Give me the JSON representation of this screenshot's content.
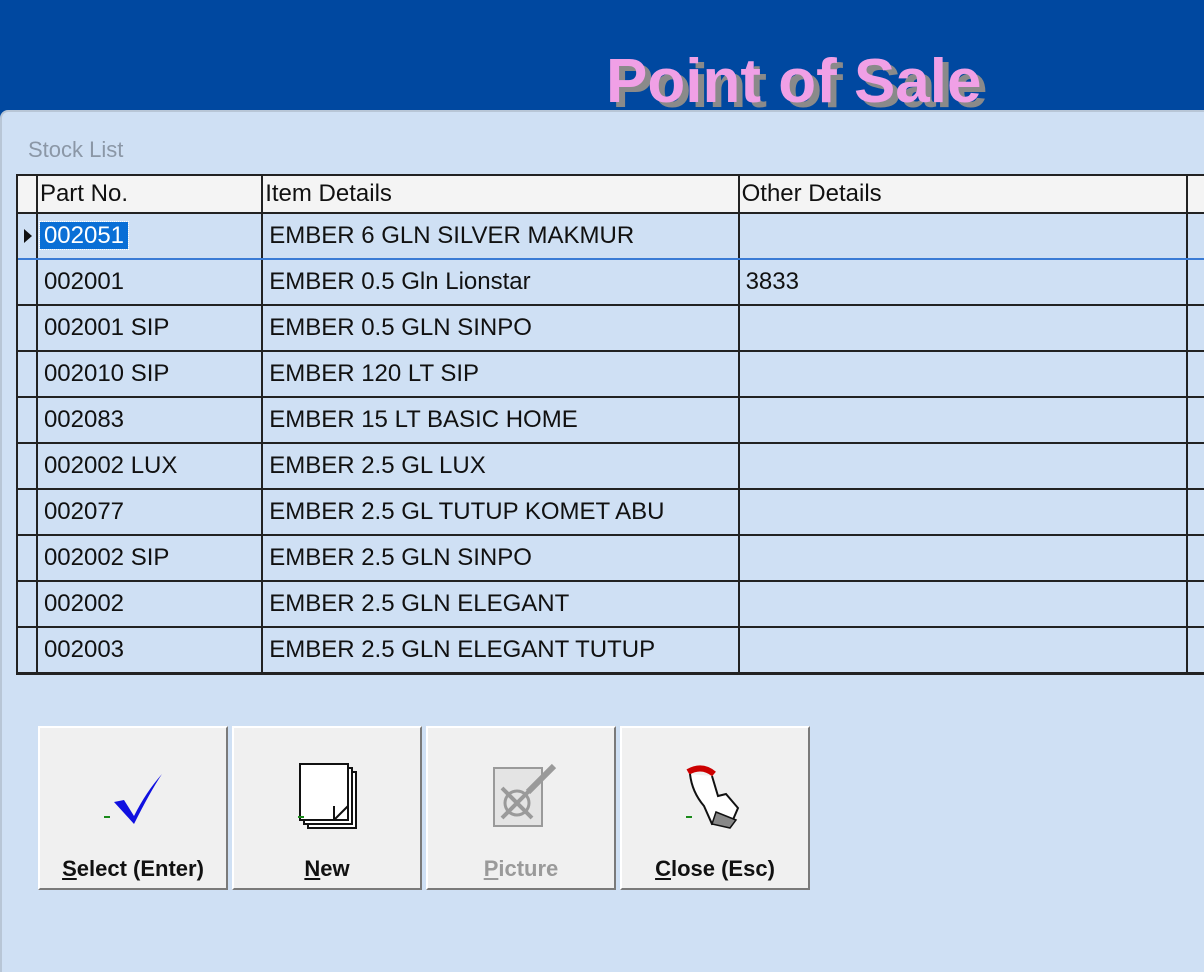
{
  "app": {
    "title": "Point of Sale"
  },
  "window": {
    "caption": "Stock List"
  },
  "grid": {
    "columns": [
      "Part No.",
      "Item Details",
      "Other Details"
    ],
    "rows": [
      {
        "part_no": "002051",
        "item_details": "EMBER  6 GLN SILVER  MAKMUR",
        "other_details": ""
      },
      {
        "part_no": "002001",
        "item_details": "EMBER 0.5 Gln Lionstar",
        "other_details": "3833"
      },
      {
        "part_no": "002001 SIP",
        "item_details": "EMBER 0.5 GLN SINPO",
        "other_details": ""
      },
      {
        "part_no": "002010 SIP",
        "item_details": "EMBER 120 LT SIP",
        "other_details": ""
      },
      {
        "part_no": "002083",
        "item_details": "EMBER 15 LT BASIC HOME",
        "other_details": ""
      },
      {
        "part_no": "002002 LUX",
        "item_details": "EMBER 2.5 GL LUX",
        "other_details": ""
      },
      {
        "part_no": "002077",
        "item_details": "EMBER 2.5 GL TUTUP KOMET ABU",
        "other_details": ""
      },
      {
        "part_no": "002002 SIP",
        "item_details": "EMBER 2.5 GLN  SINPO",
        "other_details": ""
      },
      {
        "part_no": "002002",
        "item_details": "EMBER 2.5 GLN ELEGANT",
        "other_details": ""
      },
      {
        "part_no": "002003",
        "item_details": "EMBER 2.5 GLN ELEGANT TUTUP",
        "other_details": ""
      }
    ]
  },
  "buttons": {
    "select": {
      "hotkey": "S",
      "rest": "elect (Enter)",
      "icon": "checkmark-icon",
      "enabled": true
    },
    "new": {
      "hotkey": "N",
      "rest": "ew",
      "icon": "new-document-icon",
      "enabled": true
    },
    "picture": {
      "hotkey": "P",
      "rest": "icture",
      "icon": "picture-icon",
      "enabled": false
    },
    "close": {
      "hotkey": "C",
      "rest": "lose (Esc)",
      "icon": "close-hand-icon",
      "enabled": true
    }
  },
  "colors": {
    "title_bar": "#0048a0",
    "title_text": "#f0a0e6",
    "window_bg": "#cfe0f4",
    "selection": "#0a6fd6"
  }
}
